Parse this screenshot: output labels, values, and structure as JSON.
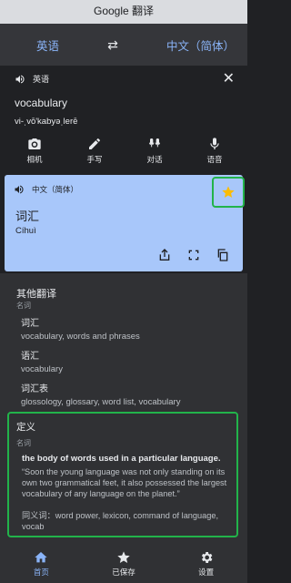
{
  "app": {
    "title": "Google 翻译"
  },
  "languages": {
    "source": "英语",
    "target": "中文（简体）",
    "swap_icon": "swap-arrows-icon"
  },
  "source": {
    "lang_label": "英语",
    "text": "vocabulary",
    "phonetic": "vi-ˌvō'kabyəˌlerē"
  },
  "tools": [
    {
      "label": "相机",
      "icon": "camera-icon"
    },
    {
      "label": "手写",
      "icon": "pen-icon"
    },
    {
      "label": "对话",
      "icon": "conversation-mic-icon"
    },
    {
      "label": "语音",
      "icon": "mic-icon"
    }
  ],
  "result": {
    "lang_label": "中文（简体）",
    "text": "词汇",
    "pinyin": "Cíhuì",
    "starred": true
  },
  "other_translations": {
    "title": "其他翻译",
    "pos": "名词",
    "items": [
      {
        "word": "词汇",
        "synonyms": "vocabulary, words and phrases"
      },
      {
        "word": "语汇",
        "synonyms": "vocabulary"
      },
      {
        "word": "词汇表",
        "synonyms": "glossology, glossary, word list, vocabulary"
      }
    ]
  },
  "definition": {
    "title": "定义",
    "pos": "名词",
    "meaning": "the body of words used in a particular language.",
    "example": "“Soon the young language was not only standing on its own two grammatical feet, it also possessed the largest vocabulary of any language on the planet.”",
    "synonyms": "同义词：word power, lexicon, command of language, vocab"
  },
  "nav": [
    {
      "label": "首页",
      "icon": "home-icon",
      "active": true
    },
    {
      "label": "已保存",
      "icon": "star-icon",
      "active": false
    },
    {
      "label": "设置",
      "icon": "gear-icon",
      "active": false
    }
  ],
  "colors": {
    "accent": "#8ab4f8",
    "result_bg": "#a8c7fa",
    "star": "#fbbc04",
    "highlight": "#22b34a"
  }
}
